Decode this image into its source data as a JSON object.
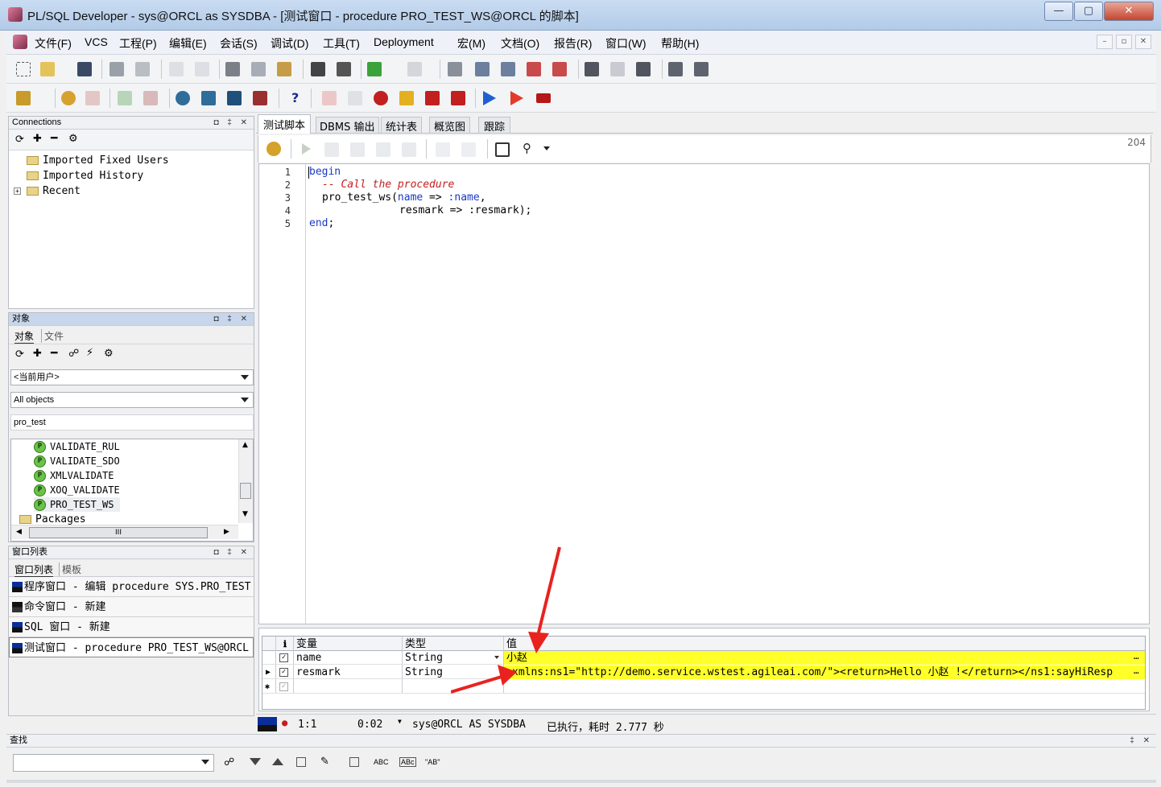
{
  "window": {
    "title": "PL/SQL Developer - sys@ORCL as SYSDBA - [测试窗口 - procedure PRO_TEST_WS@ORCL 的脚本]",
    "minimize": "—",
    "maximize": "▢",
    "close": "✕"
  },
  "menu": {
    "items": [
      "文件(F)",
      "VCS",
      "工程(P)",
      "编辑(E)",
      "会话(S)",
      "调试(D)",
      "工具(T)",
      "Deployment",
      "宏(M)",
      "文档(O)",
      "报告(R)",
      "窗口(W)",
      "帮助(H)"
    ],
    "mdi_minimize": "–",
    "mdi_restore": "▫",
    "mdi_close": "✕"
  },
  "connections": {
    "title": "Connections",
    "head_buttons": "◘ ‡ ✕",
    "items": [
      {
        "label": "Imported Fixed Users"
      },
      {
        "label": "Imported History"
      },
      {
        "label": "Recent"
      }
    ],
    "expander": "+"
  },
  "objects": {
    "title": "对象",
    "head_buttons": "◘ ‡ ✕",
    "tabs": [
      "对象",
      "文件"
    ],
    "user_select": "<当前用户>",
    "filter_select": "All objects",
    "search_value": "pro_test",
    "badge": "P",
    "items": [
      {
        "label": "VALIDATE_RUL"
      },
      {
        "label": "VALIDATE_SDO"
      },
      {
        "label": "XMLVALIDATE"
      },
      {
        "label": "XOQ_VALIDATE"
      },
      {
        "label": "PRO_TEST_WS"
      }
    ],
    "packages_label": "Packages",
    "hscroll_label": "III"
  },
  "window_list": {
    "title": "窗口列表",
    "head_buttons": "◘ ‡ ✕",
    "tabs": [
      "窗口列表",
      "模板"
    ],
    "items": [
      {
        "label": "程序窗口 - 编辑 procedure SYS.PRO_TEST"
      },
      {
        "label": "命令窗口 - 新建"
      },
      {
        "label": "SQL 窗口 - 新建"
      },
      {
        "label": "测试窗口 - procedure PRO_TEST_WS@ORCL"
      }
    ]
  },
  "editor_tabs": [
    "测试脚本",
    "DBMS 输出",
    "统计表",
    "概览图",
    "跟踪"
  ],
  "editor": {
    "counter": "204",
    "line_numbers": [
      "1",
      "2",
      "3",
      "4",
      "5"
    ]
  },
  "code": {
    "l1_kw": "begin",
    "l2_cm": "-- Call the procedure",
    "l3_a": "pro_test_ws(",
    "l3_b": "name",
    "l3_c": " => ",
    "l3_d": ":name",
    "l3_e": ",",
    "l4": "resmark => :resmark);",
    "l5_kw": "end",
    "l5_e": ";"
  },
  "grid": {
    "headers": {
      "info": "ℹ",
      "variable": "变量",
      "type": "类型",
      "value": "值"
    },
    "rows": [
      {
        "marker": "",
        "checked": "✓",
        "variable": "name",
        "type": "String",
        "value": "小赵",
        "ellipsis": "…"
      },
      {
        "marker": "▶",
        "checked": "✓",
        "variable": "resmark",
        "type": "String",
        "value": "xmlns:ns1=\"http://demo.service.wstest.agileai.com/\"><return>Hello 小赵 !</return></ns1:sayHiResp",
        "ellipsis": "…"
      },
      {
        "marker": "✱",
        "checked": "✓",
        "variable": "",
        "type": "",
        "value": ""
      }
    ]
  },
  "status": {
    "position": "1:1",
    "time": "0:02",
    "connection": "sys@ORCL AS SYSDBA",
    "message": "已执行，耗时 2.777 秒"
  },
  "find": {
    "title": "查找",
    "head_buttons": "‡ ✕",
    "input_value": "",
    "opt_abc": "ABC",
    "opt_abc_boxed": "ABc",
    "opt_ab_quoted": "\"AB\""
  },
  "colors": {
    "highlight": "#ffff2a",
    "arrow": "#e8231f",
    "keyword": "#1b39c7",
    "comment": "#c41e1e"
  }
}
